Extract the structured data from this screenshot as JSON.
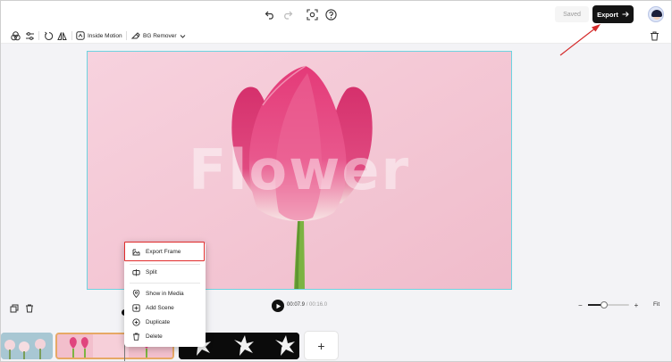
{
  "topbar": {
    "icons": [
      "undo-icon",
      "redo-icon",
      "screenshot-icon",
      "help-icon"
    ],
    "saved_label": "Saved",
    "export_label": "Export",
    "export_icon": "arrow-right-icon",
    "accent": "#141414"
  },
  "subbar": {
    "icons": [
      "color-icon",
      "adjust-icon",
      "rotate-icon",
      "flip-icon"
    ],
    "inside_motion_label": "Inside Motion",
    "bg_remover_label": "BG Remover",
    "delete_icon": "trash-icon"
  },
  "canvas": {
    "overlay_text": "Flower",
    "background": "#f3c6d4",
    "border_color": "#6dd3e0"
  },
  "context_menu": {
    "items": [
      {
        "label": "Export Frame",
        "icon": "export-frame-icon"
      },
      {
        "label": "Split",
        "icon": "split-icon"
      },
      {
        "label": "Show in Media",
        "icon": "location-icon"
      },
      {
        "label": "Add Scene",
        "icon": "add-scene-icon"
      },
      {
        "label": "Duplicate",
        "icon": "duplicate-icon"
      },
      {
        "label": "Delete",
        "icon": "trash-icon"
      }
    ],
    "highlight_color": "#e02b2b"
  },
  "playback": {
    "current_time": "00:07.9",
    "separator": "/",
    "total_time": "00:16.0"
  },
  "zoom": {
    "minus_label": "−",
    "plus_label": "+",
    "level": 0.4,
    "fit_label": "Fit"
  },
  "timeline": {
    "add_label": "+"
  }
}
